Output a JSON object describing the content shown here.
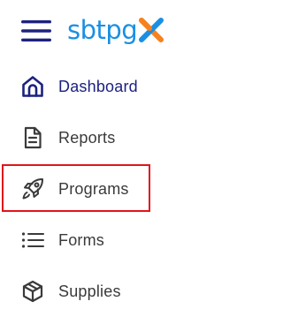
{
  "header": {
    "menu_icon": "hamburger-menu-icon",
    "logo": {
      "text": "sbtpg",
      "mark": "x",
      "text_color": "#1a8fe3",
      "mark_colors": [
        "#f5821f",
        "#1a8fe3"
      ]
    }
  },
  "nav": {
    "items": [
      {
        "label": "Dashboard",
        "icon": "home-icon",
        "active": true
      },
      {
        "label": "Reports",
        "icon": "document-icon",
        "active": false
      },
      {
        "label": "Programs",
        "icon": "rocket-icon",
        "active": false,
        "highlighted": true
      },
      {
        "label": "Forms",
        "icon": "list-icon",
        "active": false
      },
      {
        "label": "Supplies",
        "icon": "box-icon",
        "active": false
      }
    ]
  },
  "colors": {
    "active": "#1c2280",
    "text": "#3a3a3a",
    "icon": "#3a3a3a",
    "highlight": "#e0151b",
    "hamburger": "#1c2280"
  }
}
